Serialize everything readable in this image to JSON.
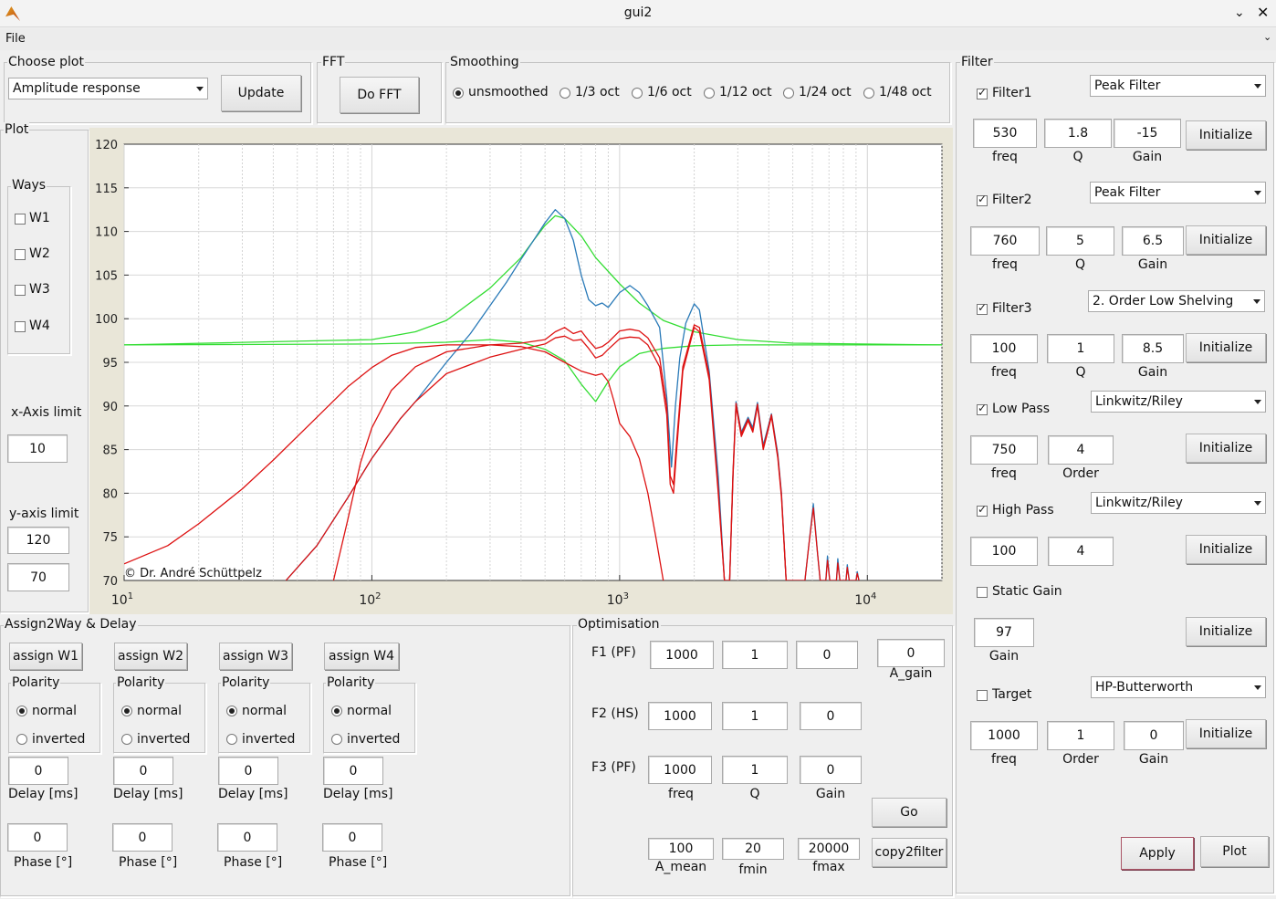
{
  "window": {
    "title": "gui2",
    "file_menu": "File"
  },
  "choose_plot": {
    "title": "Choose plot",
    "selected": "Amplitude response",
    "update": "Update"
  },
  "fft": {
    "title": "FFT",
    "button": "Do FFT"
  },
  "smoothing": {
    "title": "Smoothing",
    "options": [
      "unsmoothed",
      "1/3 oct",
      "1/6 oct",
      "1/12 oct",
      "1/24 oct",
      "1/48 oct"
    ],
    "selected_index": 0
  },
  "plot": {
    "title": "Plot",
    "ways_title": "Ways",
    "ways": [
      "W1",
      "W2",
      "W3",
      "W4"
    ],
    "xlimit_label": "x-Axis limit",
    "xlimit": "10",
    "ylimit_label": "y-axis limit",
    "ymax": "120",
    "ymin": "70",
    "copyright": "© Dr. André Schüttpelz"
  },
  "chart_data": {
    "type": "line",
    "xscale": "log",
    "xlim": [
      10,
      20000
    ],
    "ylim": [
      70,
      120
    ],
    "xticks": [
      "10^1",
      "10^2",
      "10^3",
      "10^4"
    ],
    "yticks": [
      "120",
      "115",
      "110",
      "105",
      "100",
      "95",
      "90",
      "85",
      "80",
      "75",
      "70"
    ],
    "grid": true,
    "colors": {
      "blue": "#2a7ab8",
      "green": "#33dd33",
      "red": "#dd1111"
    },
    "series": [
      {
        "color": "green",
        "points": [
          [
            10,
            97
          ],
          [
            100,
            97.1
          ],
          [
            200,
            97.3
          ],
          [
            300,
            97.6
          ],
          [
            400,
            97.3
          ],
          [
            500,
            96.5
          ],
          [
            600,
            95.2
          ],
          [
            700,
            92.5
          ],
          [
            800,
            90.5
          ],
          [
            900,
            92.8
          ],
          [
            1000,
            94.5
          ],
          [
            1200,
            96.0
          ],
          [
            1500,
            96.6
          ],
          [
            2000,
            96.9
          ],
          [
            3000,
            97
          ],
          [
            20000,
            97
          ]
        ]
      },
      {
        "color": "green",
        "points": [
          [
            10,
            97
          ],
          [
            100,
            97.6
          ],
          [
            150,
            98.5
          ],
          [
            200,
            99.8
          ],
          [
            300,
            103.5
          ],
          [
            400,
            107
          ],
          [
            450,
            109
          ],
          [
            500,
            110.7
          ],
          [
            550,
            111.8
          ],
          [
            600,
            111.5
          ],
          [
            700,
            109.5
          ],
          [
            800,
            107
          ],
          [
            1000,
            104
          ],
          [
            1200,
            101.8
          ],
          [
            1500,
            99.8
          ],
          [
            2000,
            98.5
          ],
          [
            3000,
            97.6
          ],
          [
            5000,
            97.2
          ],
          [
            20000,
            97
          ]
        ]
      },
      {
        "color": "blue",
        "points": [
          [
            45,
            70
          ],
          [
            60,
            74
          ],
          [
            80,
            79.5
          ],
          [
            100,
            84
          ],
          [
            130,
            88.5
          ],
          [
            150,
            90.5
          ],
          [
            200,
            95
          ],
          [
            250,
            98.3
          ],
          [
            300,
            101.5
          ],
          [
            350,
            104.2
          ],
          [
            400,
            106.8
          ],
          [
            450,
            109
          ],
          [
            500,
            111
          ],
          [
            550,
            112.5
          ],
          [
            600,
            111.5
          ],
          [
            650,
            109
          ],
          [
            700,
            105
          ],
          [
            750,
            102.2
          ],
          [
            800,
            101.5
          ],
          [
            850,
            101.8
          ],
          [
            900,
            101.3
          ],
          [
            1000,
            103
          ],
          [
            1100,
            103.8
          ],
          [
            1200,
            103
          ],
          [
            1300,
            101.5
          ],
          [
            1450,
            99
          ],
          [
            1550,
            91
          ],
          [
            1620,
            83
          ],
          [
            1680,
            90
          ],
          [
            1750,
            95.5
          ],
          [
            1850,
            99.5
          ],
          [
            2000,
            101.7
          ],
          [
            2100,
            101
          ],
          [
            2300,
            94
          ],
          [
            2500,
            82
          ],
          [
            2650,
            70
          ],
          [
            2780,
            70
          ],
          [
            2870,
            82
          ],
          [
            2950,
            90.5
          ],
          [
            3100,
            87
          ],
          [
            3300,
            88.7
          ],
          [
            3450,
            87.5
          ],
          [
            3600,
            90.4
          ],
          [
            3800,
            85.5
          ],
          [
            3950,
            87.3
          ],
          [
            4100,
            89.1
          ],
          [
            4350,
            84.5
          ],
          [
            4500,
            80
          ],
          [
            4700,
            70
          ],
          [
            5600,
            70
          ],
          [
            5800,
            74
          ],
          [
            6050,
            78.8
          ],
          [
            6300,
            73
          ],
          [
            6450,
            70
          ],
          [
            6800,
            70
          ],
          [
            6900,
            72.8
          ],
          [
            7050,
            70
          ],
          [
            7500,
            70
          ],
          [
            7600,
            72.5
          ],
          [
            7750,
            70
          ],
          [
            8200,
            70
          ],
          [
            8300,
            71.8
          ],
          [
            8450,
            70
          ],
          [
            9000,
            70
          ],
          [
            9100,
            71
          ],
          [
            9250,
            70
          ]
        ]
      },
      {
        "color": "red",
        "points": [
          [
            10,
            71.9
          ],
          [
            15,
            74
          ],
          [
            20,
            76.5
          ],
          [
            30,
            80.5
          ],
          [
            40,
            83.8
          ],
          [
            60,
            88.7
          ],
          [
            80,
            92.2
          ],
          [
            100,
            94.4
          ],
          [
            120,
            95.8
          ],
          [
            150,
            96.7
          ],
          [
            200,
            97
          ],
          [
            300,
            97
          ],
          [
            400,
            96.8
          ],
          [
            500,
            96.2
          ],
          [
            600,
            95
          ],
          [
            700,
            94
          ],
          [
            800,
            93.5
          ],
          [
            850,
            93.7
          ],
          [
            900,
            92.8
          ],
          [
            950,
            90.5
          ],
          [
            1000,
            88
          ],
          [
            1100,
            86.5
          ],
          [
            1200,
            84
          ],
          [
            1300,
            80
          ],
          [
            1400,
            75
          ],
          [
            1500,
            70
          ]
        ]
      },
      {
        "color": "red",
        "points": [
          [
            45,
            70
          ],
          [
            60,
            74
          ],
          [
            80,
            79.5
          ],
          [
            100,
            84
          ],
          [
            130,
            88.5
          ],
          [
            150,
            90.5
          ],
          [
            200,
            93.7
          ],
          [
            300,
            95.6
          ],
          [
            400,
            96.5
          ],
          [
            500,
            97.1
          ],
          [
            550,
            97.8
          ],
          [
            600,
            98
          ],
          [
            650,
            97.5
          ],
          [
            700,
            97.6
          ],
          [
            750,
            96.6
          ],
          [
            800,
            95.5
          ],
          [
            850,
            95.8
          ],
          [
            900,
            96.5
          ],
          [
            1000,
            97.7
          ],
          [
            1100,
            97.9
          ],
          [
            1200,
            97.8
          ],
          [
            1300,
            97
          ],
          [
            1450,
            94.5
          ],
          [
            1550,
            89
          ],
          [
            1600,
            81
          ],
          [
            1650,
            80
          ],
          [
            1700,
            85
          ],
          [
            1800,
            94
          ],
          [
            2000,
            99
          ],
          [
            2100,
            98.5
          ],
          [
            2300,
            93
          ],
          [
            2500,
            80
          ],
          [
            2650,
            70
          ],
          [
            2780,
            70
          ],
          [
            2870,
            82
          ],
          [
            2950,
            90
          ],
          [
            3100,
            86.5
          ],
          [
            3300,
            88.3
          ],
          [
            3450,
            87
          ],
          [
            3600,
            90
          ],
          [
            3800,
            85
          ],
          [
            3950,
            86.9
          ],
          [
            4100,
            88.8
          ],
          [
            4350,
            84
          ],
          [
            4500,
            79.5
          ],
          [
            4700,
            70
          ],
          [
            5600,
            70
          ],
          [
            5800,
            74
          ],
          [
            6050,
            78.3
          ],
          [
            6300,
            73
          ],
          [
            6450,
            70
          ],
          [
            6800,
            70
          ],
          [
            6900,
            72.3
          ],
          [
            7050,
            70
          ],
          [
            7500,
            70
          ],
          [
            7600,
            72
          ],
          [
            7750,
            70
          ],
          [
            8200,
            70
          ],
          [
            8300,
            71.5
          ],
          [
            8450,
            70
          ],
          [
            9000,
            70
          ],
          [
            9100,
            70.8
          ],
          [
            9250,
            70
          ]
        ]
      },
      {
        "color": "red",
        "points": [
          [
            70,
            70
          ],
          [
            80,
            77
          ],
          [
            90,
            83.5
          ],
          [
            100,
            87.5
          ],
          [
            120,
            91.8
          ],
          [
            150,
            94.5
          ],
          [
            200,
            96.2
          ],
          [
            300,
            97
          ],
          [
            400,
            97.2
          ],
          [
            500,
            97.6
          ],
          [
            550,
            98.5
          ],
          [
            600,
            99
          ],
          [
            650,
            98.3
          ],
          [
            700,
            98.6
          ],
          [
            750,
            97.5
          ],
          [
            800,
            96.6
          ],
          [
            850,
            96.8
          ],
          [
            900,
            97.3
          ],
          [
            1000,
            98.6
          ],
          [
            1100,
            98.8
          ],
          [
            1200,
            98.6
          ],
          [
            1300,
            97.8
          ],
          [
            1450,
            95.5
          ],
          [
            1550,
            90
          ],
          [
            1600,
            82
          ],
          [
            1650,
            81
          ],
          [
            1700,
            86
          ],
          [
            1800,
            94.5
          ],
          [
            2000,
            99.3
          ],
          [
            2100,
            99
          ],
          [
            2300,
            93.5
          ],
          [
            2500,
            80.5
          ],
          [
            2650,
            70
          ],
          [
            2780,
            70
          ],
          [
            2870,
            82.5
          ],
          [
            2950,
            90.3
          ],
          [
            3100,
            86.8
          ],
          [
            3300,
            88.5
          ],
          [
            3450,
            87.2
          ],
          [
            3600,
            90.2
          ],
          [
            3800,
            85.2
          ],
          [
            3950,
            87.1
          ],
          [
            4100,
            89
          ],
          [
            4350,
            84.2
          ],
          [
            4500,
            79.8
          ],
          [
            4700,
            70
          ]
        ]
      }
    ]
  },
  "assign": {
    "title": "Assign2Way & Delay",
    "ways": [
      {
        "button": "assign W1",
        "polarity": "Polarity",
        "normal": "normal",
        "inverted": "inverted",
        "delay": "0",
        "delay_label": "Delay [ms]",
        "phase": "0",
        "phase_label": "Phase [°]"
      },
      {
        "button": "assign W2",
        "polarity": "Polarity",
        "normal": "normal",
        "inverted": "inverted",
        "delay": "0",
        "delay_label": "Delay [ms]",
        "phase": "0",
        "phase_label": "Phase [°]"
      },
      {
        "button": "assign W3",
        "polarity": "Polarity",
        "normal": "normal",
        "inverted": "inverted",
        "delay": "0",
        "delay_label": "Delay [ms]",
        "phase": "0",
        "phase_label": "Phase [°]"
      },
      {
        "button": "assign W4",
        "polarity": "Polarity",
        "normal": "normal",
        "inverted": "inverted",
        "delay": "0",
        "delay_label": "Delay [ms]",
        "phase": "0",
        "phase_label": "Phase [°]"
      }
    ]
  },
  "optimisation": {
    "title": "Optimisation",
    "rows": [
      {
        "label": "F1 (PF)",
        "v": [
          "1000",
          "1",
          "0"
        ]
      },
      {
        "label": "F2 (HS)",
        "v": [
          "1000",
          "1",
          "0"
        ]
      },
      {
        "label": "F3 (PF)",
        "v": [
          "1000",
          "1",
          "0"
        ]
      }
    ],
    "col_labels": [
      "freq",
      "Q",
      "Gain"
    ],
    "a_gain": "0",
    "a_gain_label": "A_gain",
    "a_mean": "100",
    "a_mean_label": "A_mean",
    "fmin": "20",
    "fmin_label": "fmin",
    "fmax": "20000",
    "fmax_label": "fmax",
    "go": "Go",
    "copy": "copy2filter"
  },
  "filter": {
    "title": "Filter",
    "f1": {
      "label": "Filter1",
      "type": "Peak Filter",
      "freq": "530",
      "q": "1.8",
      "gain": "-15"
    },
    "f2": {
      "label": "Filter2",
      "type": "Peak Filter",
      "freq": "760",
      "q": "5",
      "gain": "6.5"
    },
    "f3": {
      "label": "Filter3",
      "type": "2. Order Low Shelving",
      "freq": "100",
      "q": "1",
      "gain": "8.5"
    },
    "lp": {
      "label": "Low Pass",
      "type": "Linkwitz/Riley",
      "freq": "750",
      "order": "4"
    },
    "hp": {
      "label": "High Pass",
      "type": "Linkwitz/Riley",
      "freq": "100",
      "order": "4"
    },
    "static": {
      "label": "Static Gain",
      "gain": "97"
    },
    "target": {
      "label": "Target",
      "type": "HP-Butterworth",
      "freq": "1000",
      "order": "1",
      "gain": "0"
    },
    "labels": {
      "freq": "freq",
      "q": "Q",
      "gain": "Gain",
      "order": "Order",
      "initialize": "Initialize"
    },
    "apply": "Apply",
    "plot": "Plot"
  }
}
